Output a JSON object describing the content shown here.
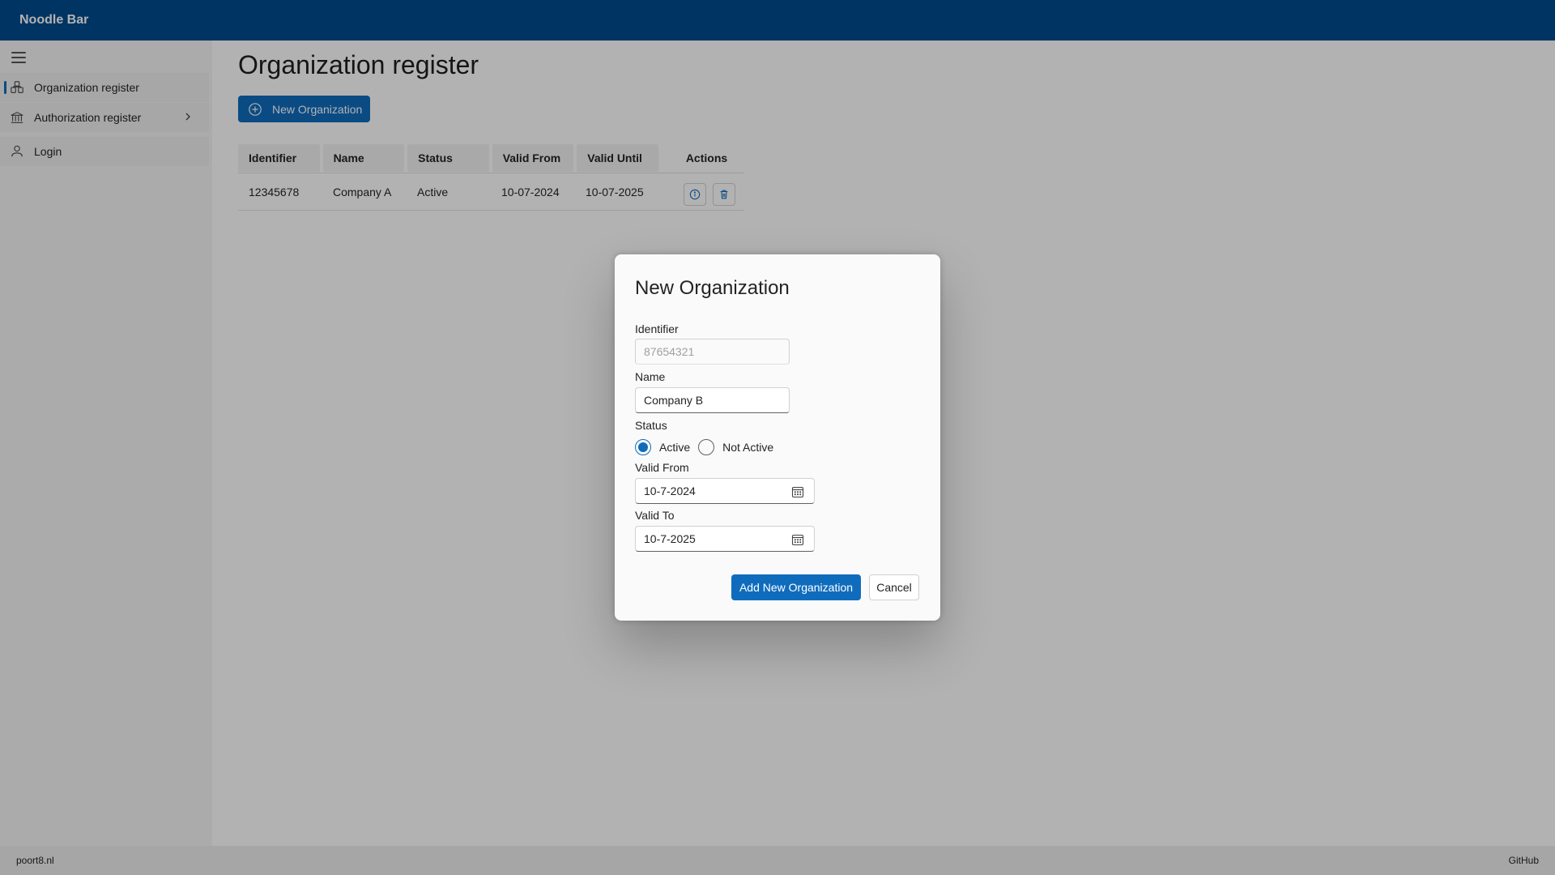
{
  "header": {
    "title": "Noodle Bar"
  },
  "sidebar": {
    "menu_icon": "hamburger-icon",
    "items": [
      {
        "label": "Organization register",
        "icon": "organization-icon",
        "active": true
      },
      {
        "label": "Authorization register",
        "icon": "bank-icon",
        "has_children": true
      },
      {
        "label": "Login",
        "icon": "person-icon"
      }
    ]
  },
  "main": {
    "title": "Organization register",
    "new_button_label": "New Organization",
    "table": {
      "columns": [
        "Identifier",
        "Name",
        "Status",
        "Valid From",
        "Valid Until",
        "Actions"
      ],
      "rows": [
        {
          "identifier": "12345678",
          "name": "Company A",
          "status": "Active",
          "valid_from": "10-07-2024",
          "valid_until": "10-07-2025"
        }
      ]
    }
  },
  "dialog": {
    "title": "New Organization",
    "identifier": {
      "label": "Identifier",
      "placeholder": "87654321",
      "value": ""
    },
    "name": {
      "label": "Name",
      "value": "Company B"
    },
    "status": {
      "label": "Status",
      "options": [
        "Active",
        "Not Active"
      ],
      "selected": "Active"
    },
    "valid_from": {
      "label": "Valid From",
      "value": "10-7-2024"
    },
    "valid_to": {
      "label": "Valid To",
      "value": "10-7-2025"
    },
    "primary_label": "Add New Organization",
    "cancel_label": "Cancel"
  },
  "footer": {
    "left": "poort8.nl",
    "right": "GitHub"
  },
  "colors": {
    "header": "#004b8f",
    "accent": "#0f6cbd"
  }
}
